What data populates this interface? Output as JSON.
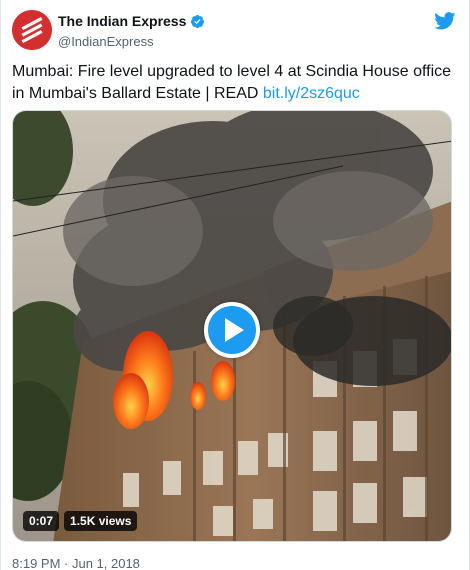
{
  "author": {
    "name": "The Indian Express",
    "handle": "@IndianExpress",
    "verified": true,
    "avatar_icon": "indian-express-logo-icon",
    "avatar_color": "#d32f2f"
  },
  "platform_icon": "twitter-bird-icon",
  "tweet": {
    "text": "Mumbai: Fire level upgraded to level 4 at Scindia House office in Mumbai's Ballard Estate | READ ",
    "link": "bit.ly/2sz6quc"
  },
  "video": {
    "play_icon": "play-icon",
    "duration": "0:07",
    "views": "1.5K views"
  },
  "meta": {
    "timestamp": "8:19 PM · Jun 1, 2018"
  },
  "colors": {
    "accent": "#1d9bf0",
    "text": "#0f1419",
    "secondary_text": "#536471"
  }
}
